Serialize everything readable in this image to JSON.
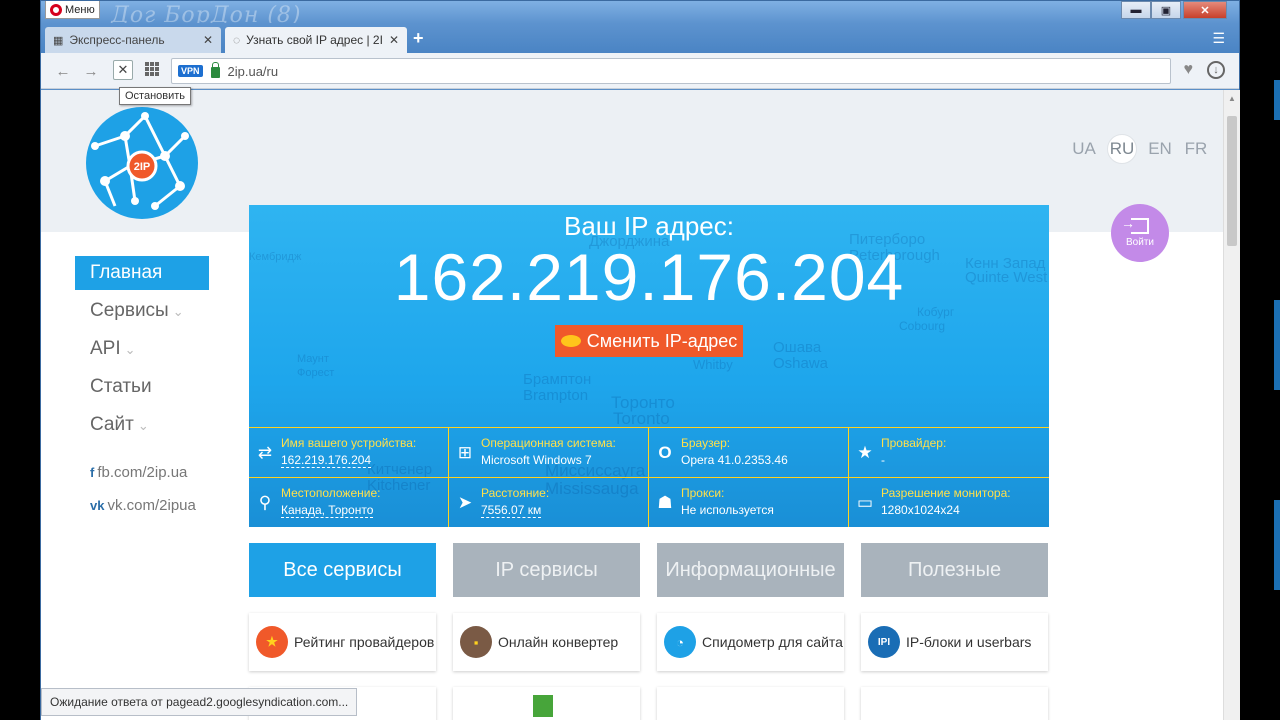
{
  "window": {
    "menu_label": "Меню",
    "watermark": "Дог БорДон (8)",
    "controls": {
      "minimize": "▬",
      "maximize": "▣",
      "close": "✕"
    }
  },
  "tabs": [
    {
      "label": "Экспресс-панель",
      "close": "✕"
    },
    {
      "label": "Узнать свой IP адрес | 2IP",
      "close": "✕"
    }
  ],
  "tab_new": "+",
  "tab_menu": "☰",
  "toolbar": {
    "back": "←",
    "forward": "→",
    "stop": "✕",
    "vpn": "VPN",
    "url": "2ip.ua/ru",
    "heart": "♥",
    "download": "↓",
    "tooltip": "Остановить"
  },
  "site": {
    "logo_text": "2IP",
    "languages": [
      "UA",
      "RU",
      "EN",
      "FR"
    ],
    "active_language": "RU",
    "login_label": "Войти",
    "nav": [
      {
        "label": "Главная",
        "chevron": ""
      },
      {
        "label": "Сервисы",
        "chevron": "⌄"
      },
      {
        "label": "API",
        "chevron": "⌄"
      },
      {
        "label": "Статьи",
        "chevron": ""
      },
      {
        "label": "Сайт",
        "chevron": "⌄"
      }
    ],
    "social": [
      {
        "icon": "f",
        "label": "fb.com/2ip.ua"
      },
      {
        "icon": "vk",
        "label": "vk.com/2ipua"
      }
    ]
  },
  "hero": {
    "title": "Ваш IP адрес:",
    "ip": "162.219.176.204",
    "change_button": "Сменить IP-адрес",
    "map_labels": [
      "Джорджина",
      "Питерборо",
      "Peterborough",
      "Кенн Запад",
      "Quinte West",
      "Кобург",
      "Cobourg",
      "Ошава",
      "Oshawa",
      "Whitby",
      "Брамптон",
      "Brampton",
      "Торонто",
      "Toronto",
      "Миссиссауга",
      "Mississauga",
      "Китченер",
      "Kitchener",
      "Маунт",
      "Форест",
      "Кембридж"
    ],
    "info": [
      {
        "icon": "⇄",
        "label": "Имя вашего устройства:",
        "value": "162.219.176.204",
        "link": true
      },
      {
        "icon": "⊞",
        "label": "Операционная система:",
        "value": "Microsoft Windows 7",
        "link": false
      },
      {
        "icon": "O",
        "label": "Браузер:",
        "value": "Opera 41.0.2353.46",
        "link": false
      },
      {
        "icon": "★",
        "label": "Провайдер:",
        "value": "-",
        "link": false
      },
      {
        "icon": "⚲",
        "label": "Местоположение:",
        "value": "Канада, Торонто",
        "link": true
      },
      {
        "icon": "➤",
        "label": "Расстояние:",
        "value": "7556.07 км",
        "link": true
      },
      {
        "icon": "☗",
        "label": "Прокси:",
        "value": "Не используется",
        "link": false
      },
      {
        "icon": "▭",
        "label": "Разрешение монитора:",
        "value": "1280x1024x24",
        "link": false
      }
    ]
  },
  "service_tabs": [
    "Все сервисы",
    "IP сервисы",
    "Информационные",
    "Полезные"
  ],
  "cards": [
    {
      "label": "Рейтинг провайдеров",
      "icon_color": "#f0592a",
      "icon": "★"
    },
    {
      "label": "Онлайн конвертер",
      "icon_color": "#7a5a45",
      "icon": "▪"
    },
    {
      "label": "Спидометр для сайта",
      "icon_color": "#1ea1e6",
      "icon": "◔"
    },
    {
      "label": "IP-блоки и userbars",
      "icon_color": "#1a6db5",
      "icon": "IPI"
    }
  ],
  "status_text": "Ожидание ответа от pagead2.googlesyndication.com..."
}
